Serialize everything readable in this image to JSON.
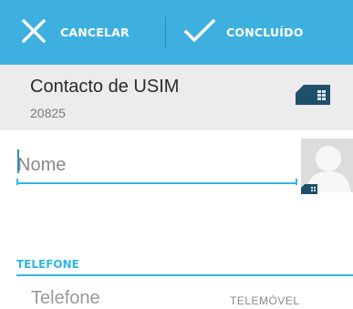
{
  "action_bar": {
    "cancel_label": "CANCELAR",
    "done_label": "CONCLUÍDO",
    "background": "#3eb0e0"
  },
  "account": {
    "title": "Contacto de USIM",
    "subtitle": "20825",
    "icon": "sim-card-icon"
  },
  "name_field": {
    "placeholder": "Nome",
    "value": ""
  },
  "photo": {
    "icon": "contact-avatar-icon"
  },
  "phone_section": {
    "header": "TELEFONE",
    "field_placeholder": "Telefone",
    "type_label": "TELEMÓVEL"
  },
  "accent_color": "#33b5e5"
}
